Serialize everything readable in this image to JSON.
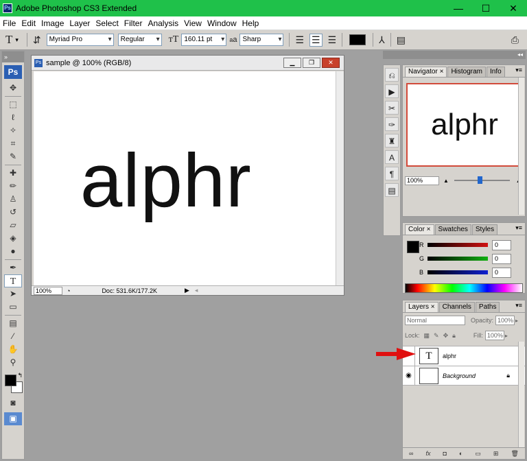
{
  "app": {
    "title": "Adobe Photoshop CS3 Extended",
    "logo": "Ps",
    "window_controls": [
      "minimize-icon",
      "maximize-icon",
      "close-icon"
    ]
  },
  "menu": [
    "File",
    "Edit",
    "Image",
    "Layer",
    "Select",
    "Filter",
    "Analysis",
    "View",
    "Window",
    "Help"
  ],
  "options": {
    "tool_glyph": "T",
    "font_family": "Myriad Pro",
    "font_style": "Regular",
    "font_size": "160.11 pt",
    "aa_label": "a",
    "antialias": "Sharp",
    "text_color": "#000000"
  },
  "toolbox": {
    "logo": "Ps",
    "tools": [
      {
        "name": "move-tool",
        "glyph": "✥"
      },
      {
        "name": "marquee-tool",
        "glyph": "⬚"
      },
      {
        "name": "lasso-tool",
        "glyph": "ℓ"
      },
      {
        "name": "magic-wand-tool",
        "glyph": "✧"
      },
      {
        "name": "crop-tool",
        "glyph": "⌗"
      },
      {
        "name": "slice-tool",
        "glyph": "✎"
      },
      {
        "name": "healing-brush-tool",
        "glyph": "✚"
      },
      {
        "name": "brush-tool",
        "glyph": "✏"
      },
      {
        "name": "clone-stamp-tool",
        "glyph": "♙"
      },
      {
        "name": "history-brush-tool",
        "glyph": "↺"
      },
      {
        "name": "eraser-tool",
        "glyph": "▱"
      },
      {
        "name": "paint-bucket-tool",
        "glyph": "◈"
      },
      {
        "name": "dodge-tool",
        "glyph": "●"
      },
      {
        "name": "pen-tool",
        "glyph": "✒"
      },
      {
        "name": "type-tool",
        "glyph": "T"
      },
      {
        "name": "path-selection-tool",
        "glyph": "➤"
      },
      {
        "name": "shape-tool",
        "glyph": "▭"
      },
      {
        "name": "notes-tool",
        "glyph": "▤"
      },
      {
        "name": "eyedropper-tool",
        "glyph": "⁄"
      },
      {
        "name": "hand-tool",
        "glyph": "✋"
      },
      {
        "name": "zoom-tool",
        "glyph": "⚲"
      }
    ],
    "foreground_color": "#000000",
    "background_color": "#ffffff"
  },
  "document": {
    "title": "sample @ 100% (RGB/8)",
    "canvas_text": "alphr",
    "zoom": "100%",
    "doc_info": "Doc: 531.6K/177.2K"
  },
  "navigator": {
    "tabs": [
      "Navigator",
      "Histogram",
      "Info"
    ],
    "preview_text": "alphr",
    "zoom": "100%"
  },
  "color": {
    "tabs": [
      "Color",
      "Swatches",
      "Styles"
    ],
    "channels": [
      {
        "label": "R",
        "value": "0",
        "color": "#d01010"
      },
      {
        "label": "G",
        "value": "0",
        "color": "#10b010"
      },
      {
        "label": "B",
        "value": "0",
        "color": "#1020d0"
      }
    ]
  },
  "layers": {
    "tabs": [
      "Layers",
      "Channels",
      "Paths"
    ],
    "blend_mode": "Normal",
    "opacity_label": "Opacity:",
    "opacity": "100%",
    "lock_label": "Lock:",
    "fill_label": "Fill:",
    "fill": "100%",
    "items": [
      {
        "name": "alphr",
        "thumb": "T"
      },
      {
        "name": "Background",
        "thumb": ""
      }
    ]
  },
  "annotation": {
    "arrow_color": "#e01010"
  }
}
